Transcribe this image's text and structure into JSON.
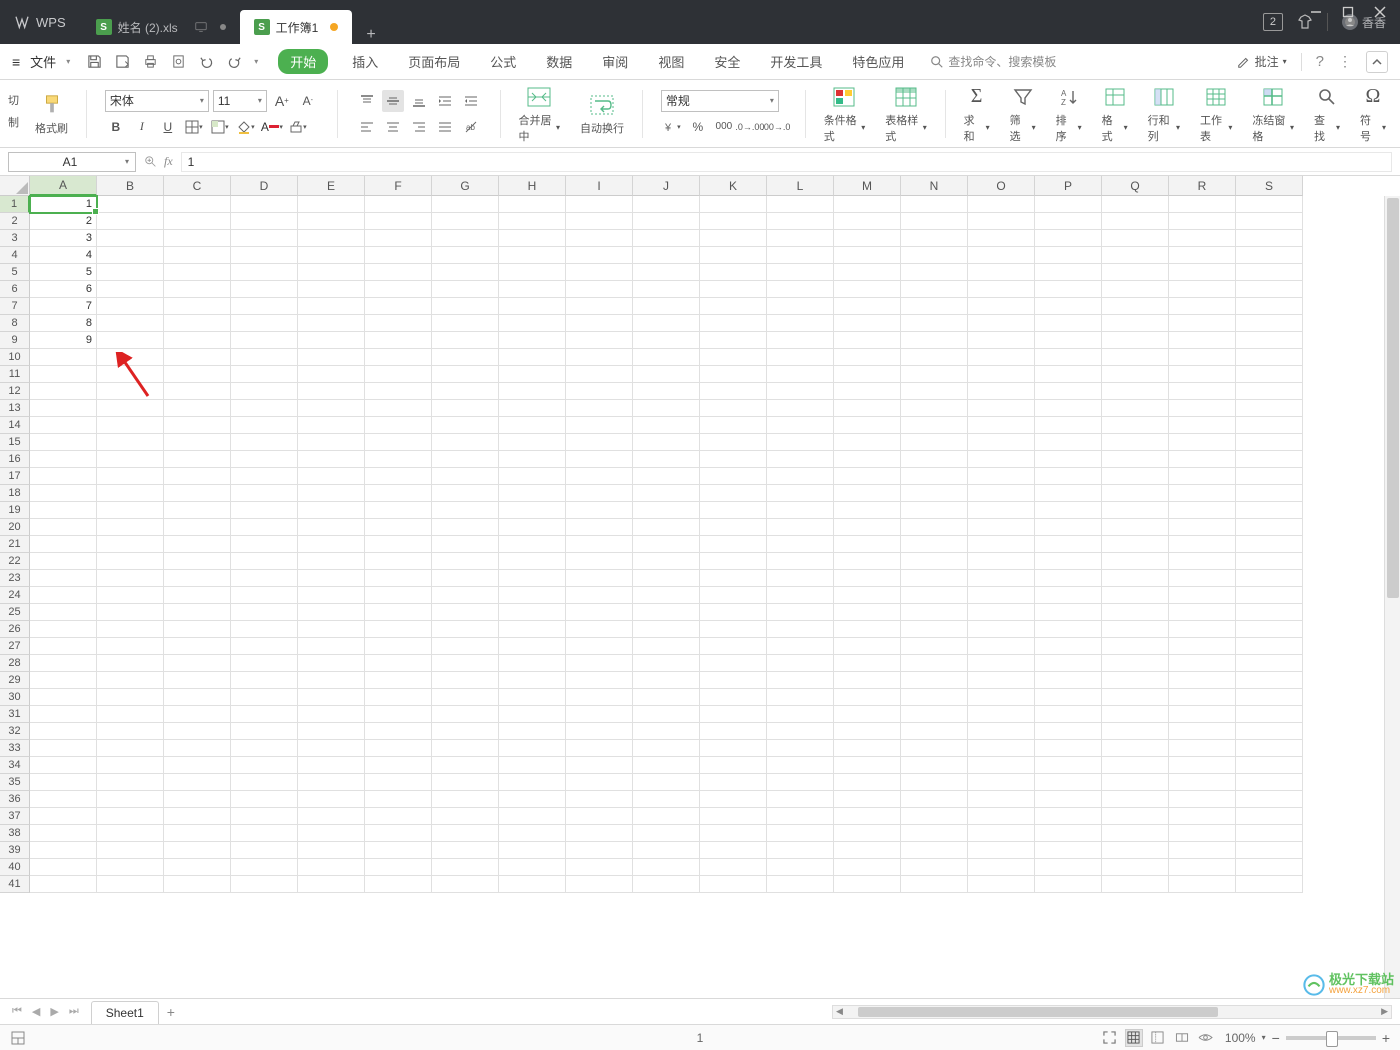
{
  "app": {
    "name": "WPS"
  },
  "window": {
    "badge": "2",
    "user": "香香"
  },
  "docTabs": [
    {
      "label": "姓名 (2).xls",
      "active": false,
      "modified": false,
      "showMonitor": true
    },
    {
      "label": "工作簿1",
      "active": true,
      "modified": true,
      "showMonitor": false
    }
  ],
  "menubar": {
    "file": "文件",
    "tabs": [
      "开始",
      "插入",
      "页面布局",
      "公式",
      "数据",
      "审阅",
      "视图",
      "安全",
      "开发工具",
      "特色应用"
    ],
    "activeTab": "开始",
    "searchPlaceholder": "查找命令、搜索模板",
    "annotate": "批注"
  },
  "ribbon": {
    "clipboard": {
      "cut": "切",
      "copy": "制",
      "formatPainter": "格式刷"
    },
    "font": {
      "name": "宋体",
      "size": "11"
    },
    "merge": "合并居中",
    "wrap": "自动换行",
    "numberFormat": "常规",
    "condFormat": "条件格式",
    "tableStyle": "表格样式",
    "sum": "求和",
    "filter": "筛选",
    "sort": "排序",
    "format": "格式",
    "rowsCols": "行和列",
    "worksheet": "工作表",
    "freeze": "冻结窗格",
    "find": "查找",
    "symbol": "符号"
  },
  "formulaBar": {
    "cellRef": "A1",
    "fx": "fx",
    "value": "1"
  },
  "grid": {
    "columns": [
      "A",
      "B",
      "C",
      "D",
      "E",
      "F",
      "G",
      "H",
      "I",
      "J",
      "K",
      "L",
      "M",
      "N",
      "O",
      "P",
      "Q",
      "R",
      "S"
    ],
    "activeCol": "A",
    "rowCount": 41,
    "activeRow": 1,
    "cells": {
      "A1": "1",
      "A2": "2",
      "A3": "3",
      "A4": "4",
      "A5": "5",
      "A6": "6",
      "A7": "7",
      "A8": "8",
      "A9": "9"
    }
  },
  "sheets": {
    "active": "Sheet1"
  },
  "statusbar": {
    "leftIcon": "⊞",
    "page": "1",
    "zoom": "100%"
  },
  "watermark": {
    "text": "极光下载站",
    "url": "www.xz7.com"
  }
}
